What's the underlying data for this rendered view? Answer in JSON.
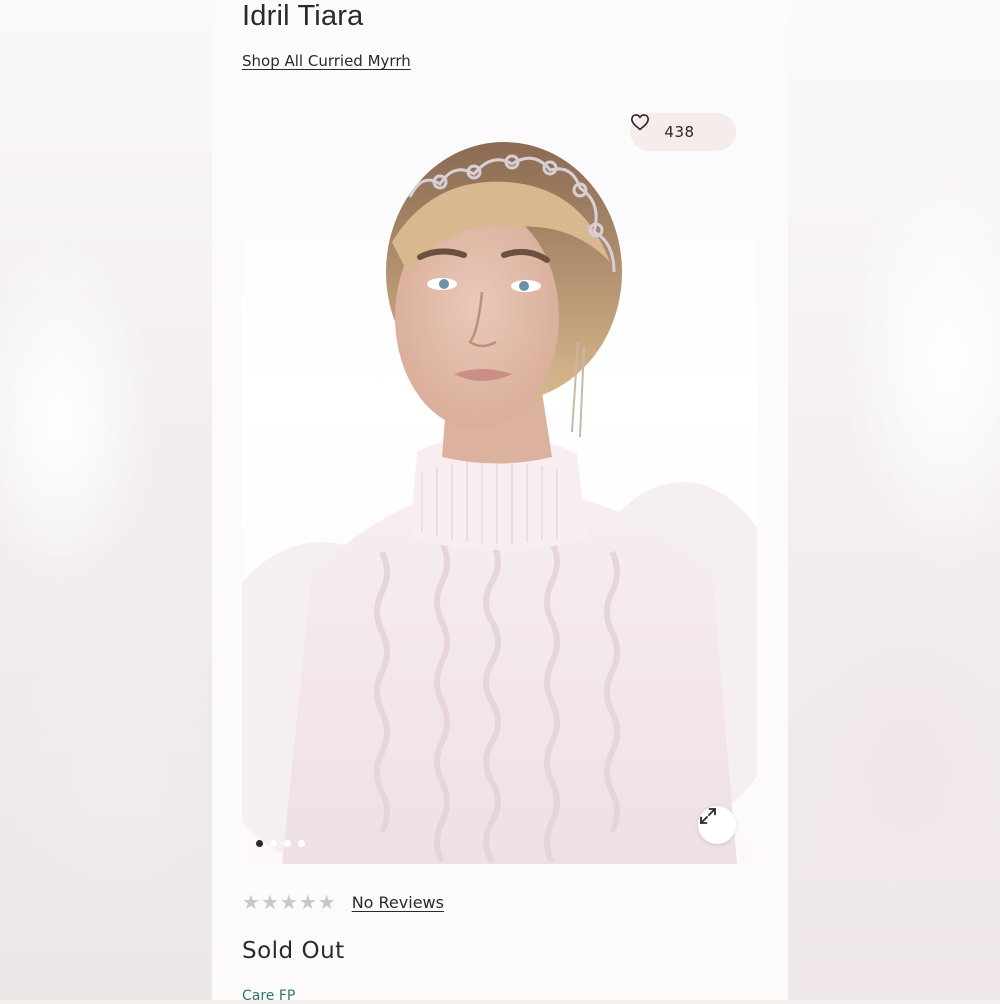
{
  "product": {
    "title": "Idril Tiara",
    "shop_link": "Shop All Curried Myrrh",
    "likes": "438",
    "rating_stars": 0,
    "reviews_link": "No Reviews",
    "status": "Sold Out",
    "care_link": "Care FP"
  },
  "gallery": {
    "total_images": 4,
    "active_index": 0
  },
  "icons": {
    "like": "heart-icon",
    "expand": "expand-arrows-icon",
    "rating": "star-icon"
  },
  "colors": {
    "text": "#2a2a2a",
    "star_empty": "#c9c6c4",
    "like_pill_bg": "#f7ecec",
    "care_link": "#2e7a6a"
  }
}
